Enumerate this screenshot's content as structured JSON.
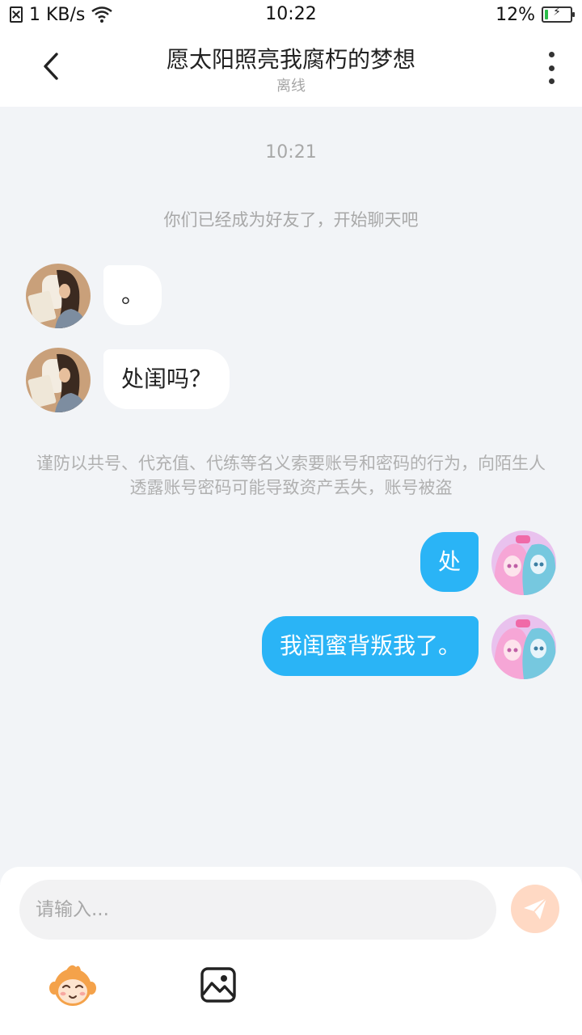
{
  "status_bar": {
    "network_speed": "1 KB/s",
    "time": "10:22",
    "battery_percent": "12%",
    "battery_level": 0.12,
    "icons": [
      "sim-off-icon",
      "wifi-icon",
      "battery-charging-icon"
    ]
  },
  "header": {
    "title": "愿太阳照亮我腐朽的梦想",
    "status": "离线",
    "icons": [
      "back-icon",
      "more-icon"
    ]
  },
  "chat": {
    "time_label": "10:21",
    "system_message": "你们已经成为好友了，开始聊天吧",
    "warning": "谨防以共号、代充值、代练等名义索要账号和密码的行为，向陌生人透露账号密码可能导致资产丢失，账号被盗",
    "messages": [
      {
        "direction": "in",
        "text": "。"
      },
      {
        "direction": "in",
        "text": "处闺吗？"
      },
      {
        "direction": "out",
        "text": "处"
      },
      {
        "direction": "out",
        "text": "我闺蜜背叛我了。"
      }
    ]
  },
  "input": {
    "placeholder": "请输入..."
  },
  "toolbar": {
    "icons": [
      "send-icon",
      "emoji-icon",
      "image-icon"
    ]
  },
  "colors": {
    "outgoing_bubble": "#2ab4f6",
    "incoming_bubble": "#ffffff",
    "chat_background": "#f2f4f7",
    "send_button": "#ffd9c4",
    "battery": "#2bbd4a"
  }
}
